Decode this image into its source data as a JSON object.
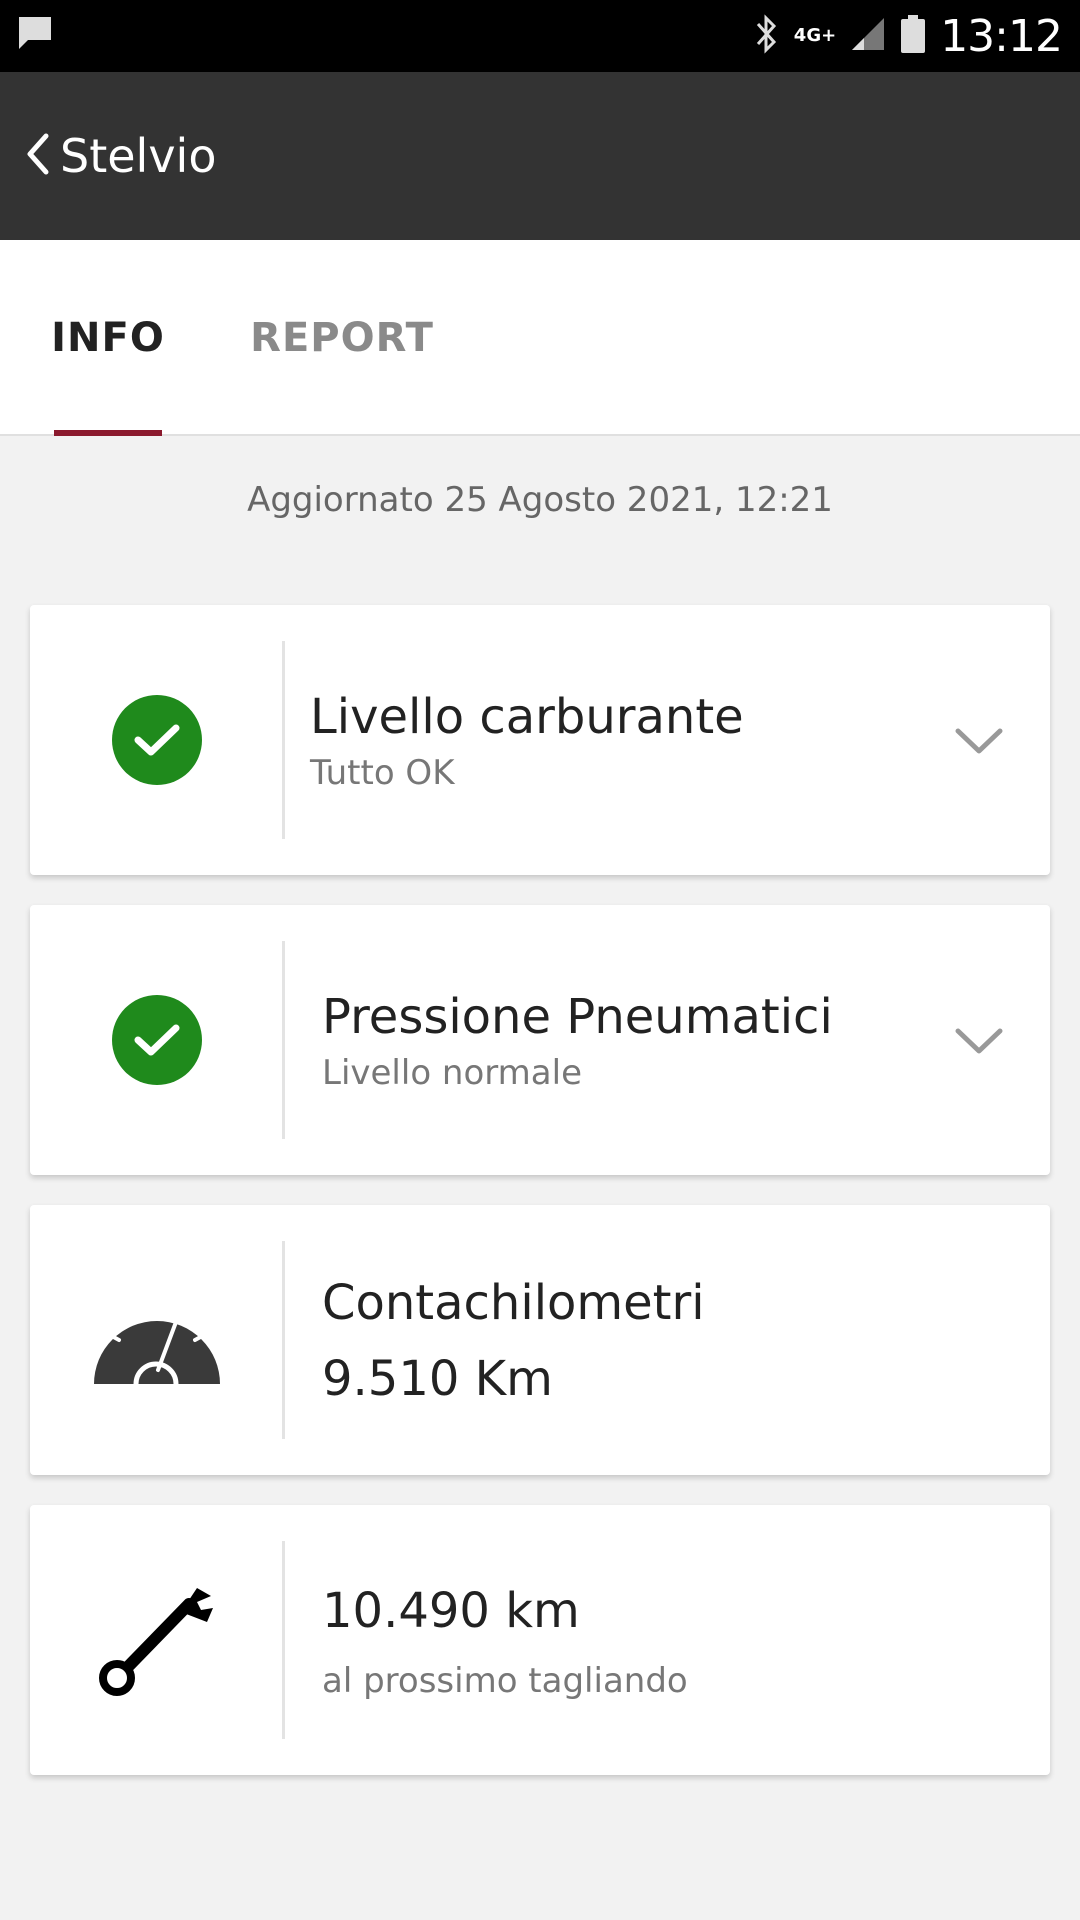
{
  "status_bar": {
    "time": "13:12",
    "network": "4G+",
    "icons": [
      "message-icon",
      "bluetooth-icon",
      "signal-icon",
      "battery-icon"
    ]
  },
  "app_bar": {
    "title": "Stelvio",
    "back_icon": "chevron-left-icon"
  },
  "tabs": [
    {
      "label": "INFO",
      "active": true
    },
    {
      "label": "REPORT",
      "active": false
    }
  ],
  "colors": {
    "accent": "#8b1a2e",
    "ok": "#1f8a1c",
    "app_bar": "#333333"
  },
  "updated_text": "Aggiornato 25 Agosto 2021, 12:21",
  "cards": [
    {
      "title": "Livello carburante",
      "subtitle": "Tutto OK",
      "icon": "check-circle-icon",
      "expandable": true
    },
    {
      "title": "Pressione Pneumatici",
      "subtitle": "Livello normale",
      "icon": "check-circle-icon",
      "expandable": true
    },
    {
      "title": "Contachilometri",
      "value": "9.510 Km",
      "icon": "speedometer-icon",
      "expandable": false
    },
    {
      "value": "10.490 km",
      "subtitle": "al prossimo tagliando",
      "icon": "wrench-icon",
      "expandable": false
    }
  ]
}
